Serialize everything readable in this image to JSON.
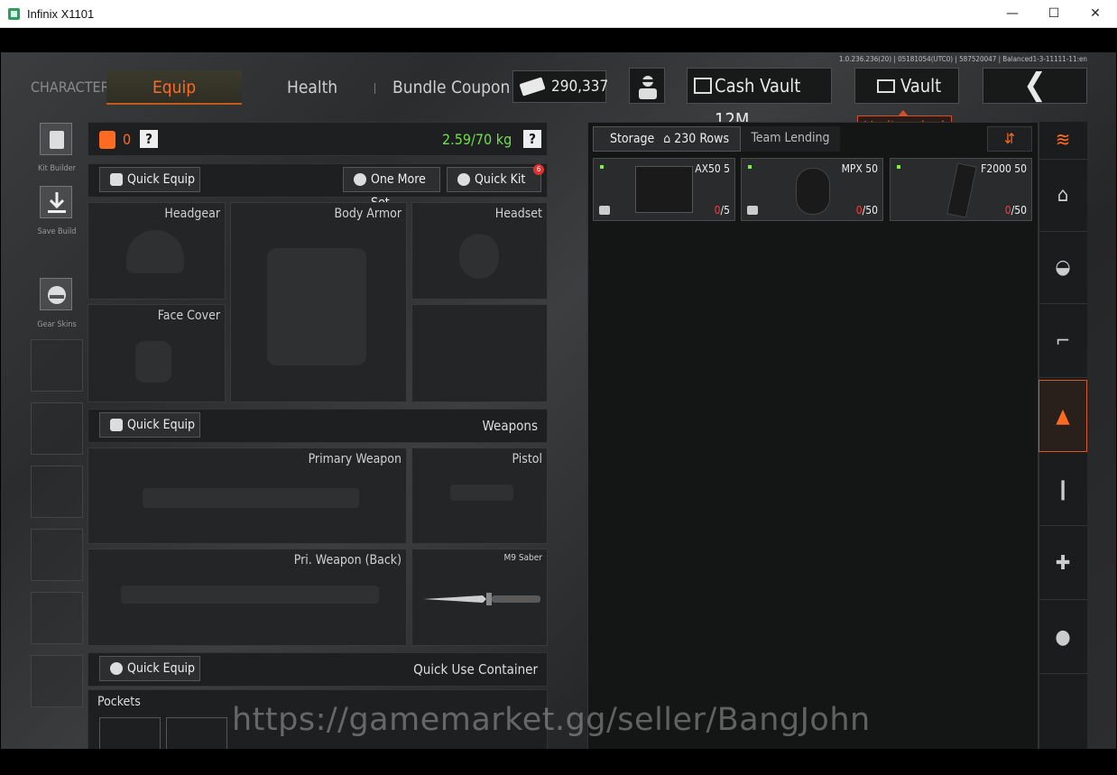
{
  "window": {
    "title": "Infinix X1101",
    "min": "—",
    "max": "☐",
    "close": "✕"
  },
  "version": "1.0.236.236(20) | 05181054(UTC0) | 587520047 | Balanced1-3-11111-11:en",
  "tabs": {
    "character": "CHARACTER",
    "equip": "Equip",
    "health": "Health",
    "bundle": "Bundle Coupon"
  },
  "currency": {
    "value": "290,337"
  },
  "header": {
    "cash_vault": "Cash Vault 12M",
    "vault": "Vault",
    "vault_status": "Vault expired",
    "back": "❮"
  },
  "sidebar": {
    "kit_builder": "Kit Builder",
    "save_build": "Save Build",
    "gear_skins": "Gear Skins"
  },
  "gear": {
    "armor_count": "0",
    "help": "?",
    "weight": "2.59/70 kg",
    "quick_equip": "Quick Equip",
    "one_more_set": "One More Set",
    "quick_kit": "Quick Kit",
    "quick_kit_badge": "6",
    "slots": {
      "headgear": "Headgear",
      "body_armor": "Body Armor",
      "headset": "Headset",
      "face_cover": "Face Cover"
    }
  },
  "weapons": {
    "quick_equip": "Quick Equip",
    "title": "Weapons",
    "primary": "Primary Weapon",
    "pistol": "Pistol",
    "primary_back": "Pri. Weapon (Back)",
    "melee": "M9 Saber"
  },
  "quick_use": {
    "quick_equip": "Quick Equip",
    "title": "Quick Use Container",
    "pockets": "Pockets"
  },
  "storage": {
    "tab_label": "Storage",
    "rows": "230 Rows",
    "lending": "Team Lending",
    "items": [
      {
        "name": "AX50 5",
        "zero": "0",
        "cap": "/5"
      },
      {
        "name": "MPX 50",
        "zero": "0",
        "cap": "/50"
      },
      {
        "name": "F2000 50",
        "zero": "0",
        "cap": "/50"
      }
    ]
  },
  "watermark": "https://gamemarket.gg/seller/BangJohn",
  "accent": "#ff6a22"
}
